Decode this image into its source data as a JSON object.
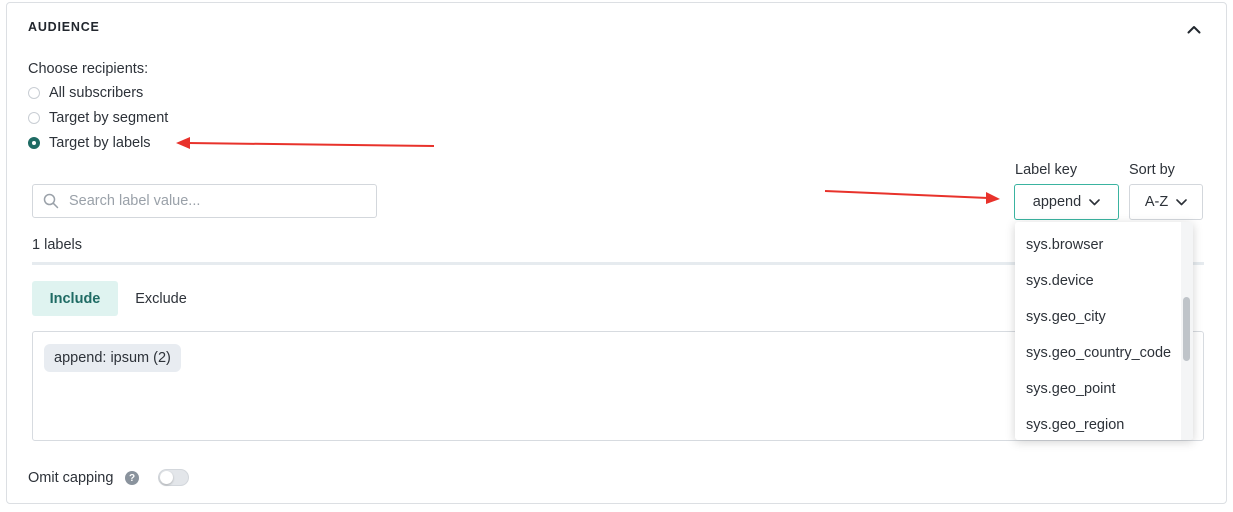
{
  "section": {
    "title": "AUDIENCE",
    "collapse_icon": "chevron-up-icon"
  },
  "recipients": {
    "label": "Choose recipients:",
    "options": [
      {
        "label": "All subscribers",
        "checked": false
      },
      {
        "label": "Target by segment",
        "checked": false
      },
      {
        "label": "Target by labels",
        "checked": true
      }
    ]
  },
  "search": {
    "placeholder": "Search label value...",
    "value": "",
    "icon": "search-icon"
  },
  "labels_count": "1 labels",
  "tabs": [
    {
      "label": "Include",
      "active": true
    },
    {
      "label": "Exclude",
      "active": false
    }
  ],
  "selected_labels": [
    {
      "text": "append: ipsum (2)"
    }
  ],
  "label_key": {
    "label": "Label key",
    "value": "append",
    "options": [
      "sys.browser",
      "sys.device",
      "sys.geo_city",
      "sys.geo_country_code",
      "sys.geo_point",
      "sys.geo_region"
    ]
  },
  "sort_by": {
    "label": "Sort by",
    "value": "A-Z"
  },
  "omit_capping": {
    "label": "Omit capping",
    "help": "?",
    "enabled": false
  },
  "colors": {
    "accent": "#1f6b64",
    "include_bg": "#dff3f0",
    "select_border": "#3ab3a0",
    "arrow": "#e8322b"
  }
}
